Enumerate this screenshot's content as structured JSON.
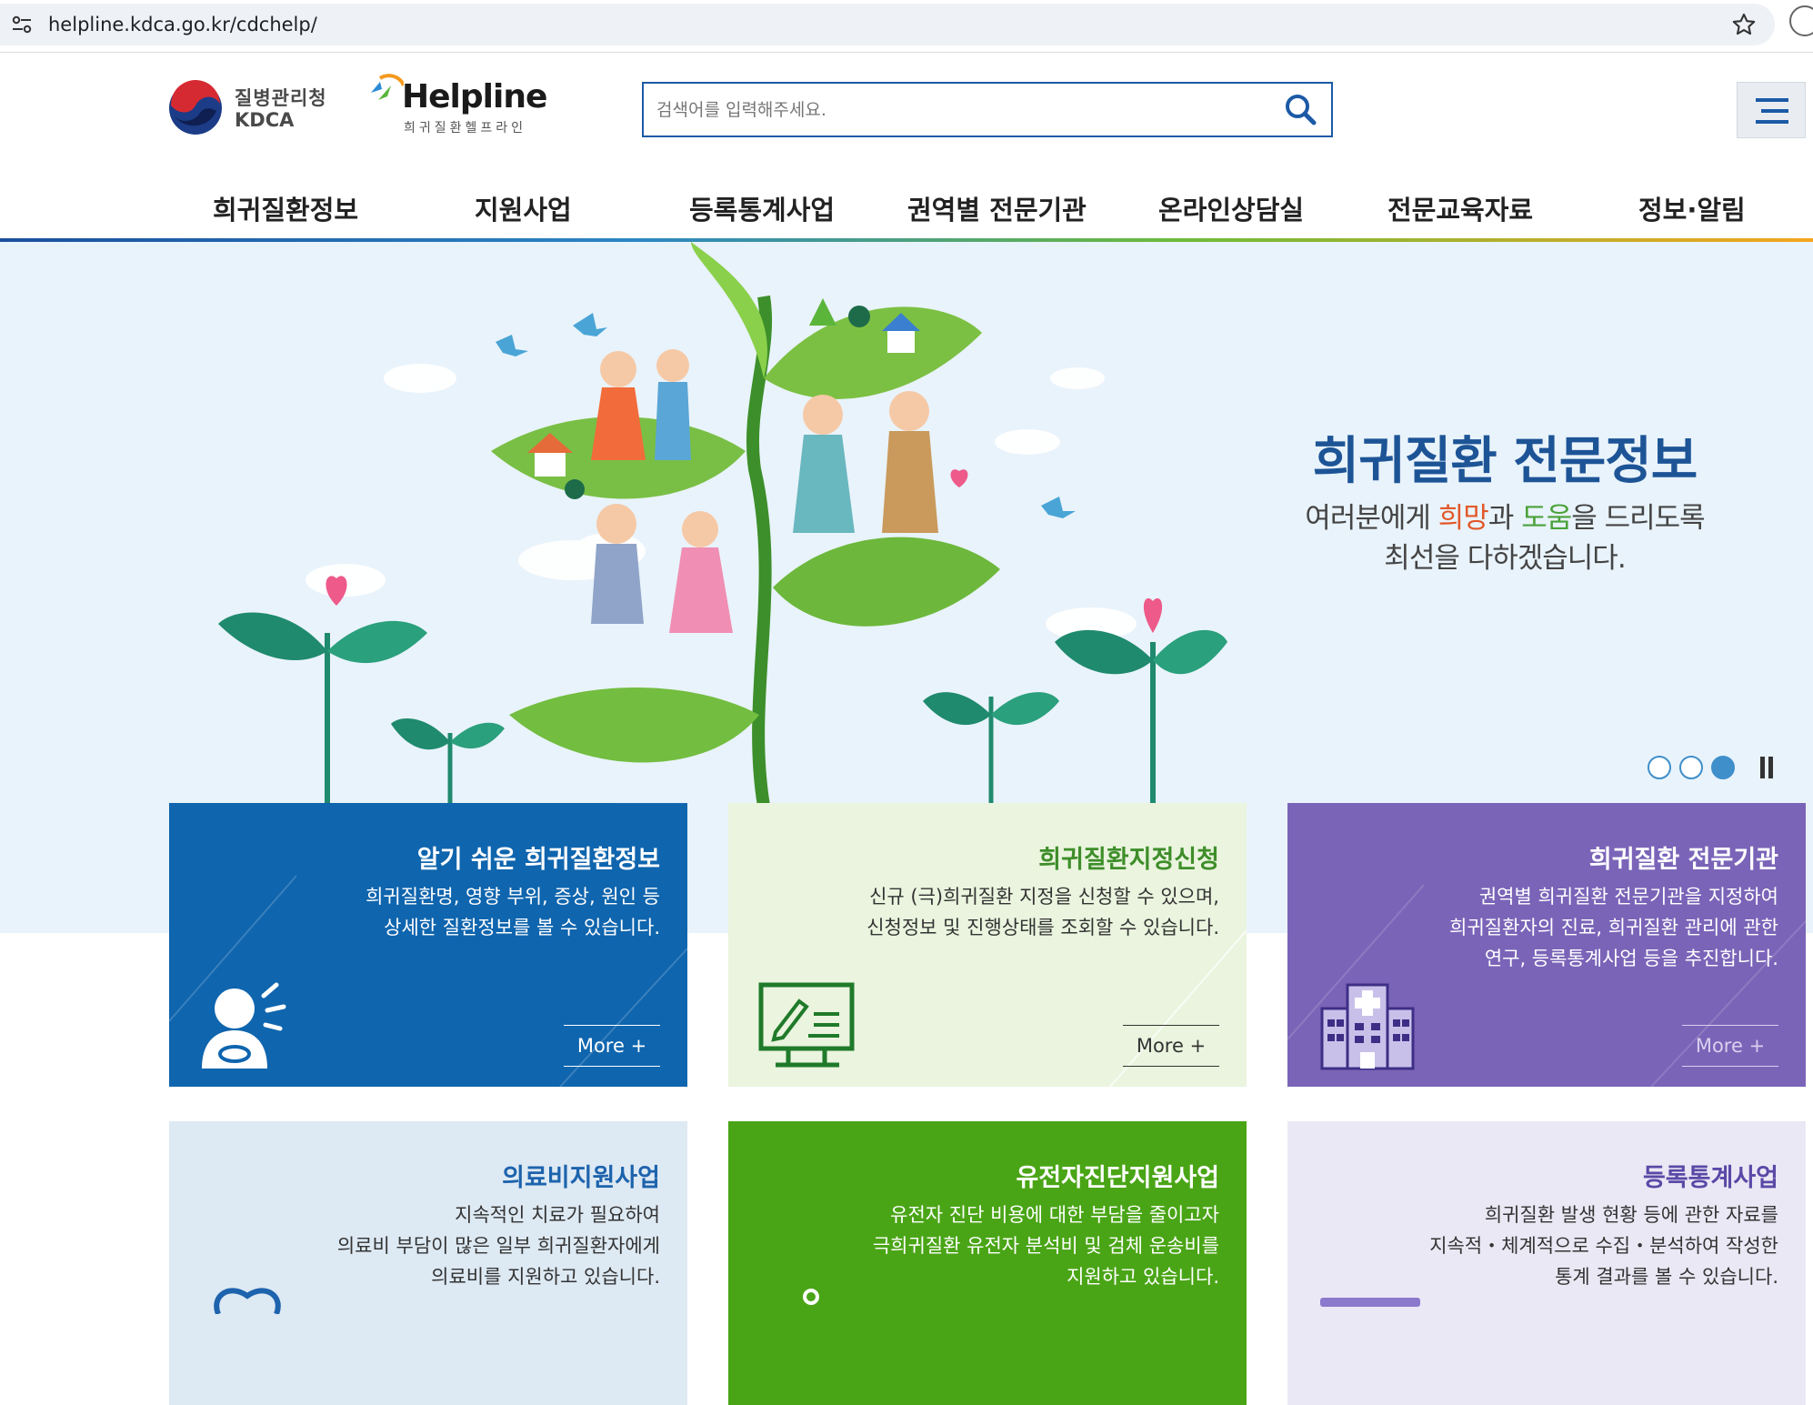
{
  "browser": {
    "url": "helpline.kdca.go.kr/cdchelp/"
  },
  "header": {
    "kdca_name": "질병관리청",
    "kdca_abbr": "KDCA",
    "helpline_title": "Helpline",
    "helpline_sub": "희귀질환헬프라인",
    "search_placeholder": "검색어를 입력해주세요."
  },
  "nav": {
    "items": [
      {
        "label": "희귀질환정보"
      },
      {
        "label": "지원사업"
      },
      {
        "label": "등록통계사업"
      },
      {
        "label": "권역별 전문기관"
      },
      {
        "label": "온라인상담실"
      },
      {
        "label": "전문교육자료"
      },
      {
        "label": "정보·알림"
      }
    ]
  },
  "hero": {
    "title": "희귀질환 전문정보",
    "desc_1_pre": "여러분에게 ",
    "desc_1_hope": "희망",
    "desc_1_mid": "과 ",
    "desc_1_help": "도움",
    "desc_1_post": "을 드리도록",
    "desc_2": "최선을 다하겠습니다.",
    "slide_count": 3,
    "active_slide": 3
  },
  "cards": [
    {
      "title": "알기 쉬운 희귀질환정보",
      "desc": [
        "희귀질환명, 영향 부위, 증상, 원인 등",
        "상세한 질환정보를 볼 수 있습니다."
      ],
      "more": "More +",
      "icon": "person-info-icon"
    },
    {
      "title": "희귀질환지정신청",
      "desc": [
        "신규 (극)희귀질환 지정을 신청할 수 있으며,",
        "신청정보 및 진행상태를 조회할 수 있습니다."
      ],
      "more": "More +",
      "icon": "monitor-edit-icon"
    },
    {
      "title": "희귀질환 전문기관",
      "desc": [
        "권역별 희귀질환 전문기관을 지정하여",
        "희귀질환자의 진료, 희귀질환 관리에 관한",
        "연구, 등록통계사업 등을 추진합니다."
      ],
      "more": "More +",
      "icon": "hospital-icon"
    },
    {
      "title": "의료비지원사업",
      "desc": [
        "지속적인 치료가 필요하여",
        "의료비 부담이 많은 일부 희귀질환자에게",
        "의료비를 지원하고 있습니다."
      ]
    },
    {
      "title": "유전자진단지원사업",
      "desc": [
        "유전자 진단 비용에 대한 부담을 줄이고자",
        "극희귀질환 유전자 분석비 및 검체 운송비를",
        "지원하고 있습니다."
      ]
    },
    {
      "title": "등록통계사업",
      "desc": [
        "희귀질환 발생 현황 등에 관한 자료를",
        "지속적・체계적으로 수집・분석하여 작성한",
        "통계 결과를 볼 수 있습니다."
      ]
    }
  ],
  "colors": {
    "primary_blue": "#0f65ae",
    "light_green": "#eaf4de",
    "purple": "#7a64b8",
    "light_blue": "#dde9f3",
    "green": "#4aa516",
    "lavender": "#ebe8f5"
  }
}
